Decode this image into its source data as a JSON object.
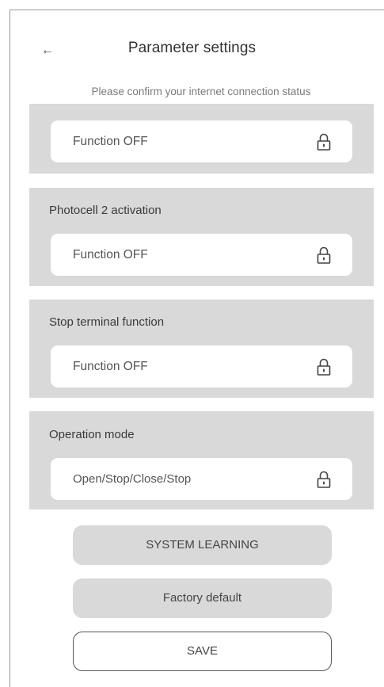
{
  "header": {
    "back_icon": "←",
    "title": "Parameter settings",
    "subtitle": "Please confirm your internet connection status"
  },
  "settings": [
    {
      "label": "",
      "value": "Function OFF",
      "icon": "lock-icon"
    },
    {
      "label": "Photocell 2 activation",
      "value": "Function OFF",
      "icon": "lock-icon"
    },
    {
      "label": "Stop terminal function",
      "value": "Function OFF",
      "icon": "lock-icon"
    },
    {
      "label": "Operation mode",
      "value": "Open/Stop/Close/Stop",
      "icon": "lock-icon"
    }
  ],
  "buttons": {
    "system_learning": "SYSTEM LEARNING",
    "factory_default": "Factory default",
    "save": "SAVE"
  },
  "colors": {
    "card_background": "#d9d9d9",
    "field_background": "#ffffff",
    "frame_border": "#9a9a9a"
  }
}
